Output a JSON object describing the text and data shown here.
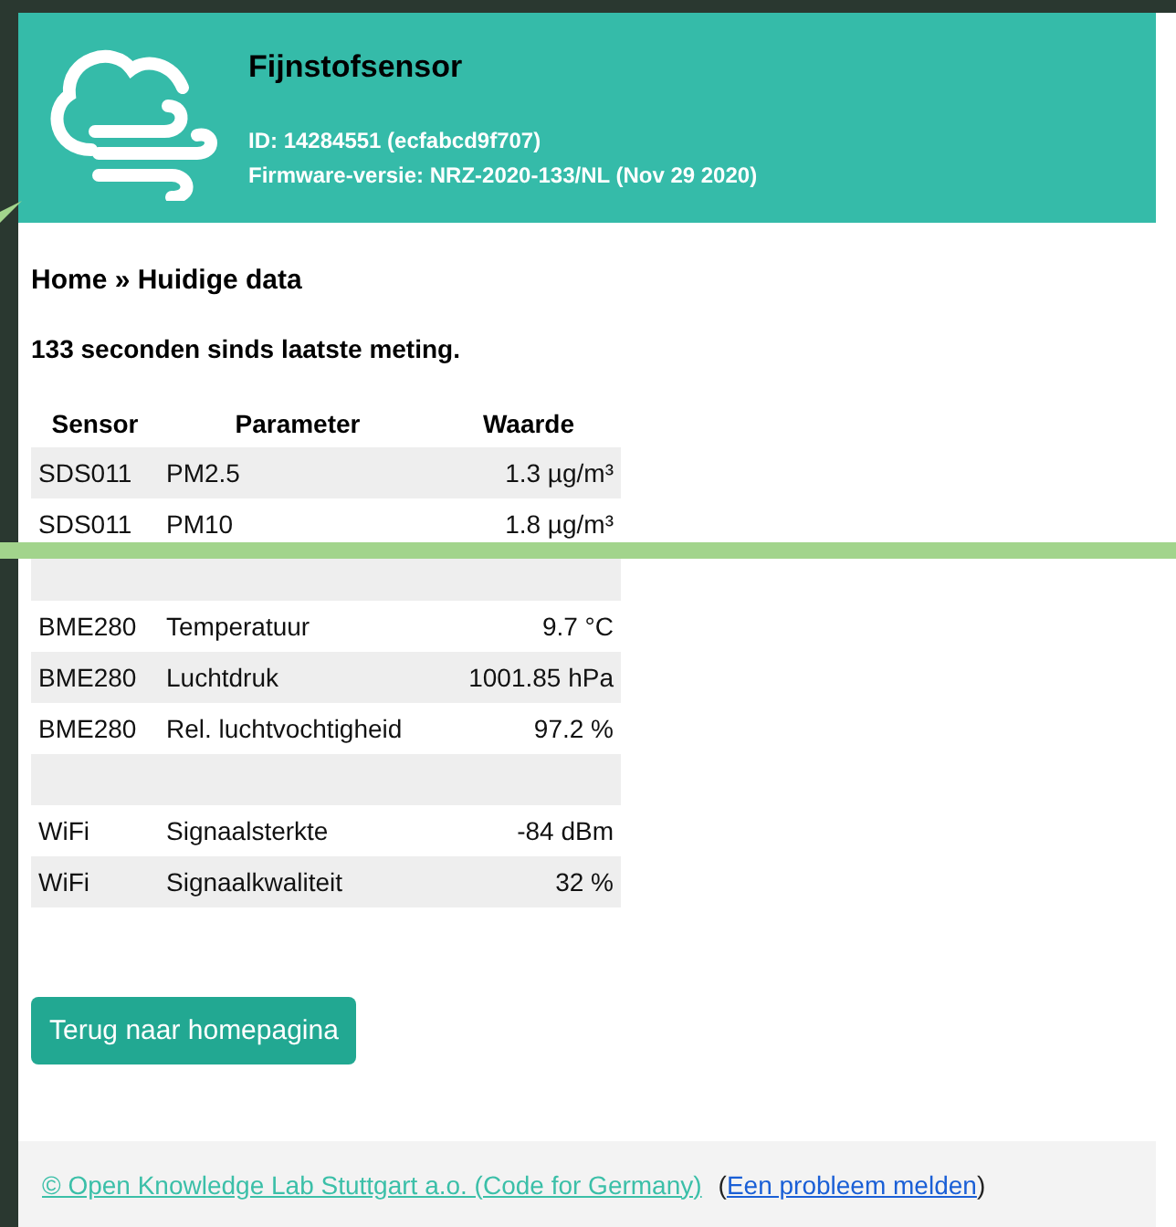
{
  "header": {
    "title": "Fijnstofsensor",
    "id_line": "ID: 14284551 (ecfabcd9f707)",
    "firmware_line": "Firmware-versie: NRZ-2020-133/NL (Nov 29 2020)"
  },
  "breadcrumb": "Home » Huidige data",
  "status": "133 seconden sinds laatste meting.",
  "table": {
    "columns": [
      "Sensor",
      "Parameter",
      "Waarde"
    ],
    "rows": [
      {
        "kind": "reading",
        "sensor": "SDS011",
        "parameter": "PM2.5",
        "value": "1.3 µg/m³"
      },
      {
        "kind": "reading",
        "sensor": "SDS011",
        "parameter": "PM10",
        "value": "1.8 µg/m³"
      },
      {
        "kind": "spacer"
      },
      {
        "kind": "reading",
        "sensor": "BME280",
        "parameter": "Temperatuur",
        "value": "9.7 °C"
      },
      {
        "kind": "reading",
        "sensor": "BME280",
        "parameter": "Luchtdruk",
        "value": "1001.85 hPa"
      },
      {
        "kind": "reading",
        "sensor": "BME280",
        "parameter": "Rel. luchtvochtigheid",
        "value": "97.2 %"
      },
      {
        "kind": "spacer"
      },
      {
        "kind": "reading",
        "sensor": "WiFi",
        "parameter": "Signaalsterkte",
        "value": "-84 dBm"
      },
      {
        "kind": "reading",
        "sensor": "WiFi",
        "parameter": "Signaalkwaliteit",
        "value": "32 %"
      }
    ]
  },
  "back_button": "Terug naar homepagina",
  "footer": {
    "credit_link": "© Open Knowledge Lab Stuttgart a.o. (Code for Germany)",
    "open_paren": "(",
    "report_link": "Een probleem melden",
    "close_paren": ")"
  }
}
